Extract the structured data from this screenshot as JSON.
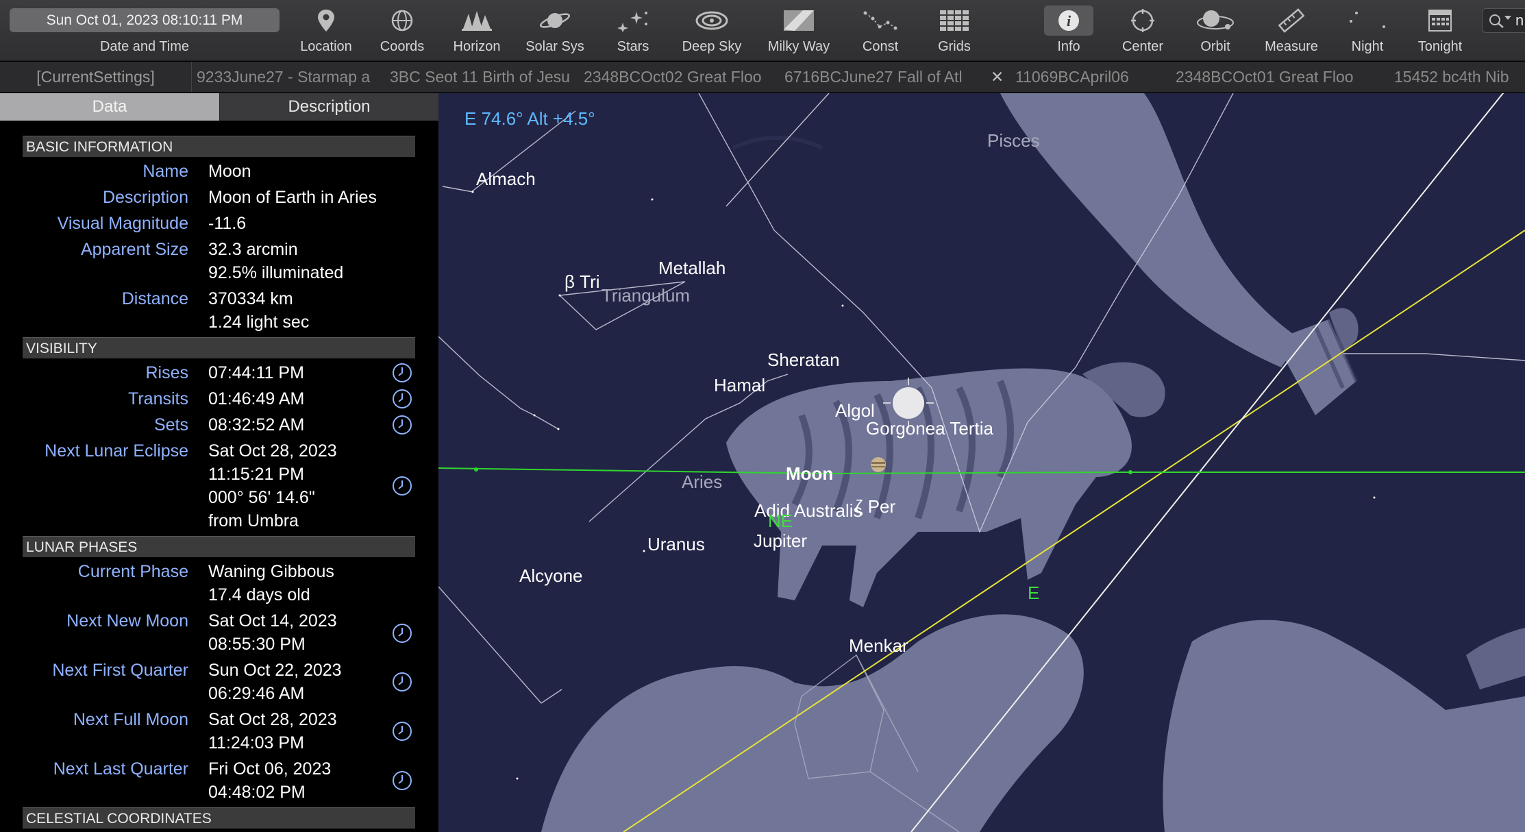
{
  "toolbar": {
    "datetime": "Sun Oct 01, 2023  08:10:11 PM",
    "datetime_caption": "Date and Time",
    "buttons": [
      {
        "label": "Location"
      },
      {
        "label": "Coords"
      },
      {
        "label": "Horizon"
      },
      {
        "label": "Solar Sys"
      },
      {
        "label": "Stars"
      },
      {
        "label": "Deep Sky"
      },
      {
        "label": "Milky Way"
      },
      {
        "label": "Const"
      },
      {
        "label": "Grids"
      },
      {
        "label": "Info"
      },
      {
        "label": "Center"
      },
      {
        "label": "Orbit"
      },
      {
        "label": "Measure"
      },
      {
        "label": "Night"
      },
      {
        "label": "Tonight"
      }
    ],
    "search_partial": "n"
  },
  "history": {
    "current": "[CurrentSettings]",
    "items": [
      "9233June27 - Starmap a",
      "3BC Seot 11 Birth of Jesu",
      "2348BCOct02 Great Floo",
      "6716BCJune27 Fall of Atl",
      "11069BCApril06",
      "2348BCOct01 Great Floo",
      "15452 bc4th Nib"
    ],
    "close_glyph": "✕"
  },
  "panel": {
    "tabs": {
      "data": "Data",
      "description": "Description"
    },
    "basic": {
      "header": "BASIC INFORMATION",
      "name_label": "Name",
      "name": "Moon",
      "desc_label": "Description",
      "desc": "Moon of Earth in Aries",
      "mag_label": "Visual Magnitude",
      "mag": "-11.6",
      "size_label": "Apparent Size",
      "size": "32.3 arcmin",
      "illum": "92.5% illuminated",
      "dist_label": "Distance",
      "dist_km": "370334 km",
      "dist_ls": "1.24 light sec"
    },
    "visibility": {
      "header": "VISIBILITY",
      "rises_label": "Rises",
      "rises": "07:44:11 PM",
      "transits_label": "Transits",
      "transits": "01:46:49 AM",
      "sets_label": "Sets",
      "sets": "08:32:52 AM",
      "eclipse_label": "Next Lunar Eclipse",
      "eclipse_date": "Sat Oct 28, 2023",
      "eclipse_time": "11:15:21 PM",
      "eclipse_sep": "000° 56' 14.6\"",
      "eclipse_from": "from Umbra"
    },
    "phases": {
      "header": "LUNAR PHASES",
      "current_label": "Current Phase",
      "current": "Waning Gibbous",
      "age": "17.4 days old",
      "new_label": "Next New Moon",
      "new_date": "Sat Oct 14, 2023",
      "new_time": "08:55:30 PM",
      "first_label": "Next First Quarter",
      "first_date": "Sun Oct 22, 2023",
      "first_time": "06:29:46 AM",
      "full_label": "Next Full Moon",
      "full_date": "Sat Oct 28, 2023",
      "full_time": "11:24:03 PM",
      "last_label": "Next Last Quarter",
      "last_date": "Fri Oct 06, 2023",
      "last_time": "04:48:02 PM"
    },
    "celestial": {
      "header": "CELESTIAL COORDINATES"
    }
  },
  "sky": {
    "readout": "E 74.6° Alt +4.5°",
    "labels": {
      "almach": "Almach",
      "beta_tri": "β Tri",
      "metallah": "Metallah",
      "sheratan": "Sheratan",
      "hamal": "Hamal",
      "algol": "Algol",
      "gorgonea": "Gorgonea Tertia",
      "moon": "Moon",
      "adid": "Adid Australis",
      "jupiter": "Jupiter",
      "zeta_per": "ζ Per",
      "uranus": "Uranus",
      "alcyone": "Alcyone",
      "menkar": "Menkar"
    },
    "constellations": {
      "triangulum": "Triangulum",
      "aries": "Aries",
      "pisces": "Pisces"
    },
    "horizon": {
      "ne": "NE",
      "e": "E"
    },
    "colors": {
      "horizon": "#2fd62f",
      "ecliptic": "#e6e23a",
      "readout": "#5fb8ff",
      "label": "#8fb2ff"
    }
  }
}
